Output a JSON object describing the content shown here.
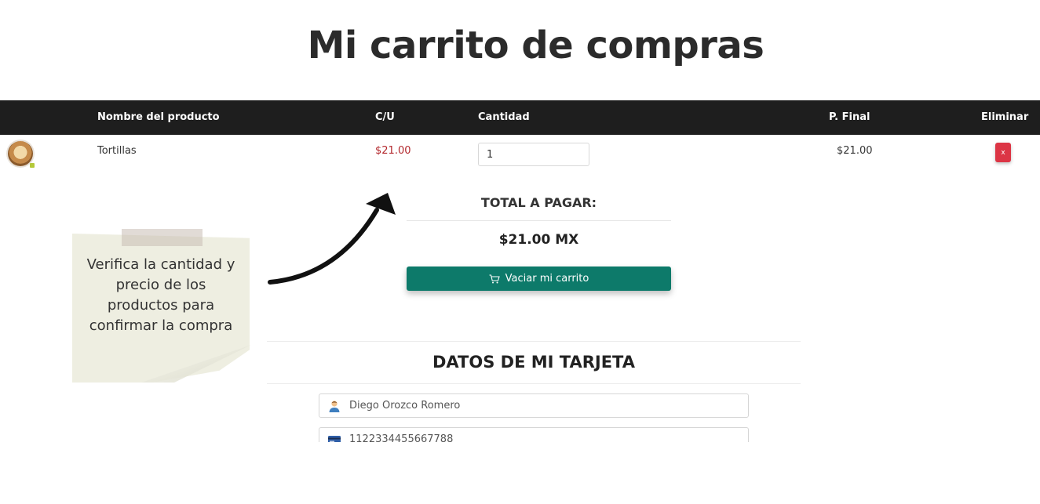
{
  "page": {
    "title": "Mi carrito de compras"
  },
  "table": {
    "headers": {
      "product_name": "Nombre del producto",
      "unit_price": "C/U",
      "quantity": "Cantidad",
      "final_price": "P. Final",
      "remove": "Eliminar"
    },
    "rows": [
      {
        "name": "Tortillas",
        "unit_price": "$21.00",
        "quantity": "1",
        "final_price": "$21.00",
        "remove_label": "x"
      }
    ]
  },
  "summary": {
    "total_label": "TOTAL A PAGAR:",
    "total_amount": "$21.00 MX",
    "empty_cart_label": "Vaciar mi carrito"
  },
  "card": {
    "title": "DATOS DE MI TARJETA",
    "holder_name": "Diego Orozco Romero",
    "card_number": "1122334455667788"
  },
  "annotation": {
    "note_text": "Verifica la cantidad y\nprecio de los\nproductos para\nconfirmar la compra"
  },
  "colors": {
    "header_bg": "#1e1e1e",
    "price_red": "#b3282d",
    "primary_green": "#0d7a6a",
    "danger": "#dc3545",
    "note_paper": "#eeeee1"
  },
  "icons": {
    "product_thumb": "tortilla-image",
    "cart": "cart-icon",
    "holder": "user-icon",
    "card": "credit-card-icon",
    "arrow": "curved-arrow-icon"
  }
}
